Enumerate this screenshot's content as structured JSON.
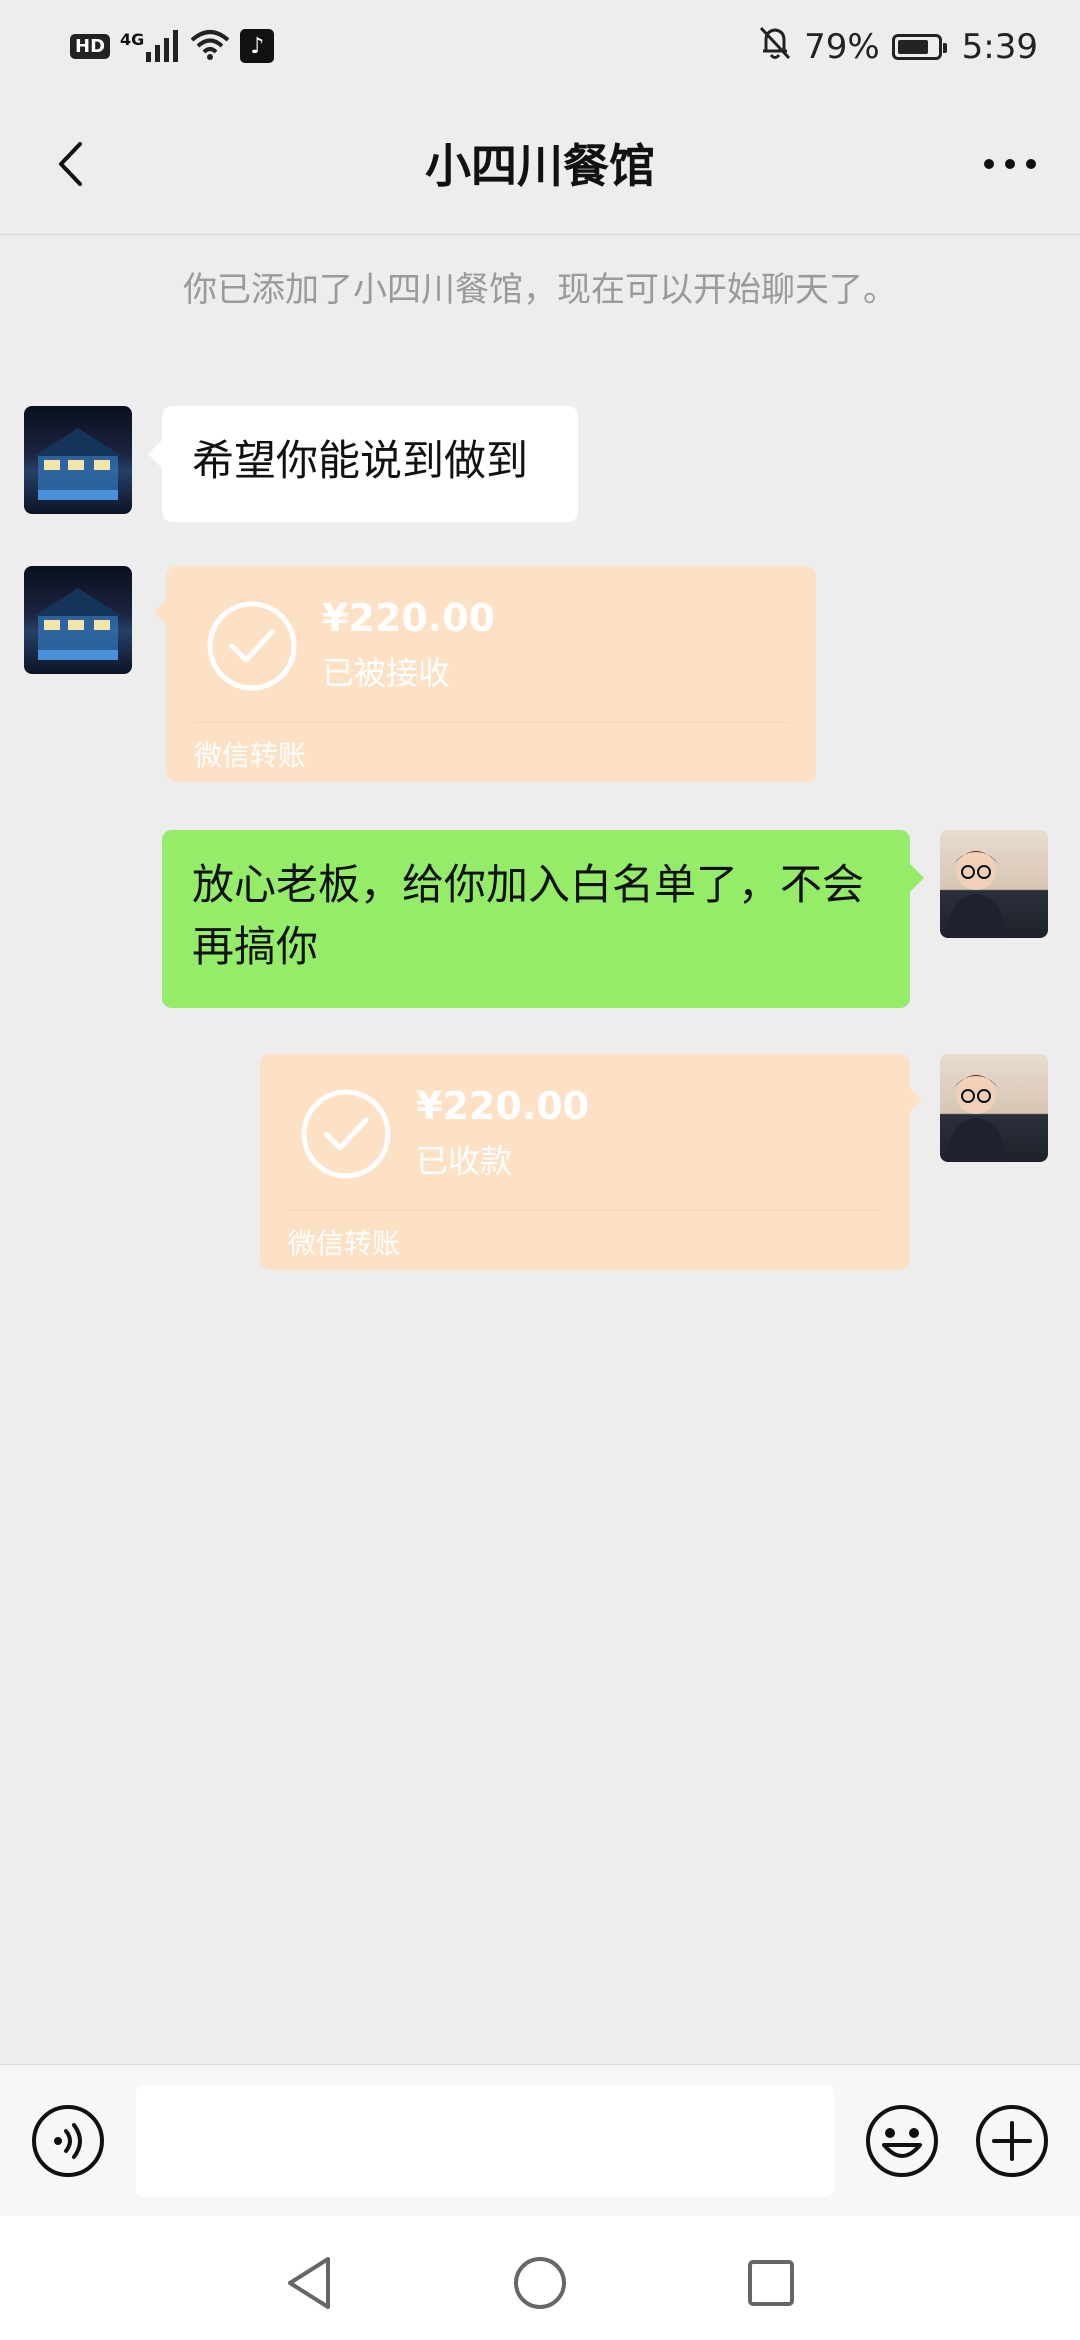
{
  "status_bar": {
    "network_badge": "HD",
    "signal_label": "4G",
    "battery_percent_text": "79%",
    "battery_level": 0.79,
    "time": "5:39",
    "icons": [
      "hd-icon",
      "signal-icon",
      "wifi-icon",
      "tiktok-icon",
      "mute-bell-icon",
      "battery-icon"
    ]
  },
  "header": {
    "title": "小四川餐馆",
    "back_icon": "chevron-left-icon",
    "more_icon": "more-dots-icon"
  },
  "system_message": "你已添加了小四川餐馆，现在可以开始聊天了。",
  "messages": [
    {
      "side": "left",
      "type": "text",
      "text": "希望你能说到做到"
    },
    {
      "side": "left",
      "type": "transfer",
      "amount": "¥220.00",
      "status": "已被接收",
      "label": "微信转账"
    },
    {
      "side": "right",
      "type": "text",
      "text": "放心老板，给你加入白名单了，不会再搞你"
    },
    {
      "side": "right",
      "type": "transfer",
      "amount": "¥220.00",
      "status": "已收款",
      "label": "微信转账"
    }
  ],
  "input_bar": {
    "input_value": "",
    "icons": [
      "voice-icon",
      "emoji-icon",
      "plus-icon"
    ]
  },
  "nav_bar": {
    "icons": [
      "nav-back-icon",
      "nav-home-icon",
      "nav-recents-icon"
    ]
  },
  "colors": {
    "background": "#ededed",
    "bubble_self": "#95ec69",
    "bubble_other": "#ffffff",
    "transfer_card": "#fde1c5"
  }
}
